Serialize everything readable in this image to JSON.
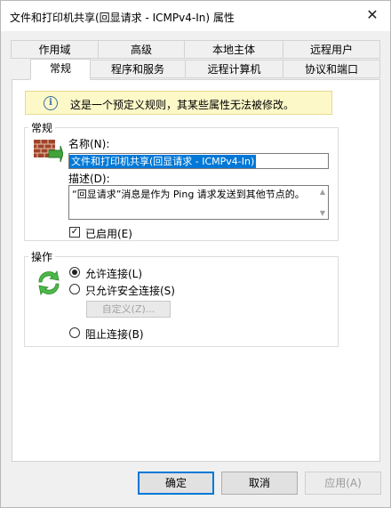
{
  "window": {
    "title": "文件和打印机共享(回显请求 - ICMPv4-In) 属性"
  },
  "tabs_row1": [
    "作用域",
    "高级",
    "本地主体",
    "远程用户"
  ],
  "tabs_row2": [
    "常规",
    "程序和服务",
    "远程计算机",
    "协议和端口"
  ],
  "info": {
    "text": "这是一个预定义规则，其某些属性无法被修改。"
  },
  "general": {
    "group_label": "常规",
    "name_label": "名称(N):",
    "name_value": "文件和打印机共享(回显请求 - ICMPv4-In)",
    "desc_label": "描述(D):",
    "desc_value": "“回显请求”消息是作为 Ping 请求发送到其他节点的。",
    "enabled_label": "已启用(E)",
    "enabled": true
  },
  "action": {
    "group_label": "操作",
    "allow_label": "允许连接(L)",
    "secure_label": "只允许安全连接(S)",
    "customize_label": "自定义(Z)...",
    "block_label": "阻止连接(B)",
    "selected": "allow"
  },
  "buttons": {
    "ok": "确定",
    "cancel": "取消",
    "apply": "应用(A)"
  },
  "icons": [
    "firewall-icon",
    "action-arrows-icon",
    "info-icon",
    "close-icon"
  ]
}
